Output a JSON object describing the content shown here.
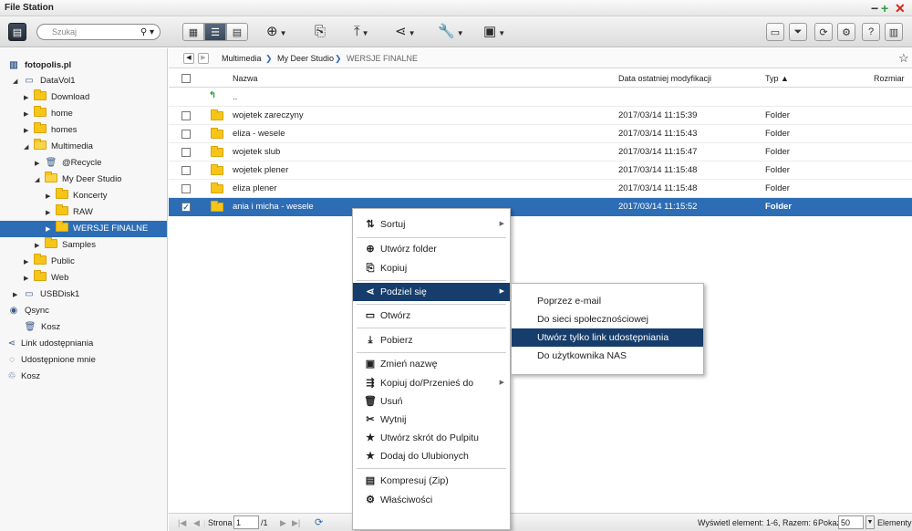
{
  "app": {
    "title": "File Station"
  },
  "toolbar": {
    "search_placeholder": "Szukaj"
  },
  "tree": {
    "root": "fotopolis.pl",
    "datavol": "DataVol1",
    "items": [
      "Download",
      "home",
      "homes",
      "Multimedia",
      "@Recycle",
      "My Deer Studio",
      "Koncerty",
      "RAW",
      "WERSJE FINALNE",
      "Samples",
      "Public",
      "Web"
    ],
    "usb": "USBDisk1",
    "qsync": "Qsync",
    "qsync_trash": "Kosz",
    "share_link": "Link udostępniania",
    "shared_with_me": "Udostępnione mnie",
    "trash": "Kosz"
  },
  "breadcrumb": {
    "items": [
      "Multimedia",
      "My Deer Studio",
      "WERSJE FINALNE"
    ]
  },
  "table": {
    "headers": {
      "name": "Nazwa",
      "date": "Data ostatniej modyfikacji",
      "type": "Typ ▲",
      "size": "Rozmiar"
    },
    "up": "..",
    "rows": [
      {
        "name": "wojetek zareczyny",
        "date": "2017/03/14 11:15:39",
        "type": "Folder"
      },
      {
        "name": "eliza - wesele",
        "date": "2017/03/14 11:15:43",
        "type": "Folder"
      },
      {
        "name": "wojetek slub",
        "date": "2017/03/14 11:15:47",
        "type": "Folder"
      },
      {
        "name": "wojetek plener",
        "date": "2017/03/14 11:15:48",
        "type": "Folder"
      },
      {
        "name": "eliza plener",
        "date": "2017/03/14 11:15:48",
        "type": "Folder"
      },
      {
        "name": "ania i micha - wesele",
        "date": "2017/03/14 11:15:52",
        "type": "Folder"
      }
    ]
  },
  "status": {
    "page_label": "Strona",
    "page_value": "1",
    "page_total": "/1",
    "summary": "Wyświetl element: 1-6, Razem: 6",
    "show_label": "Pokaż",
    "per_page": "50",
    "elements": "Elementy"
  },
  "context_menu": {
    "items": [
      "Sortuj",
      "Utwórz folder",
      "Kopiuj",
      "Podziel się",
      "Otwórz",
      "Pobierz",
      "Zmień nazwę",
      "Kopiuj do/Przenieś do",
      "Usuń",
      "Wytnij",
      "Utwórz skrót do Pulpitu",
      "Dodaj do Ulubionych",
      "Kompresuj (Zip)",
      "Właściwości"
    ]
  },
  "share_submenu": {
    "items": [
      "Poprzez e-mail",
      "Do sieci społecznościowej",
      "Utwórz tylko link udostępniania",
      "Do użytkownika NAS"
    ]
  },
  "colors": {
    "selection": "#2d6db5",
    "menu_highlight": "#163d6b",
    "close": "#d9221a",
    "add": "#2e9b3d"
  }
}
